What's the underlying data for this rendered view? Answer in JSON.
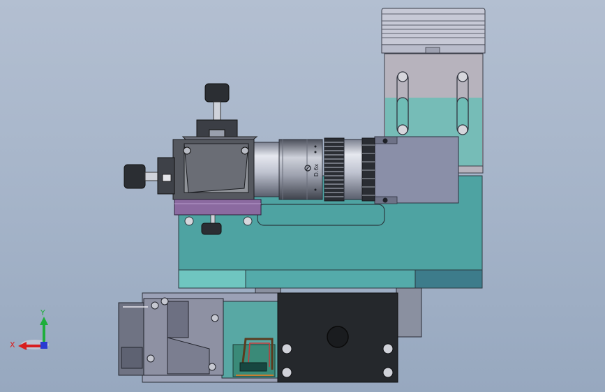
{
  "viewport": {
    "background_top": "#b3bfd1",
    "background_bottom": "#97a8bf"
  },
  "lens": {
    "marking": "D.6x"
  },
  "triad": {
    "x_label": "X",
    "y_label": "Y",
    "x_color": "#d81e1e",
    "y_color": "#1fae3c",
    "z_color": "#2a3cd1"
  },
  "colors": {
    "base_teal": "#4ea3a2",
    "base_light": "#66c3c0",
    "purple_plate": "#8b6aa0",
    "motor_dark": "#25282c",
    "housing_grey": "#8a90a8"
  }
}
